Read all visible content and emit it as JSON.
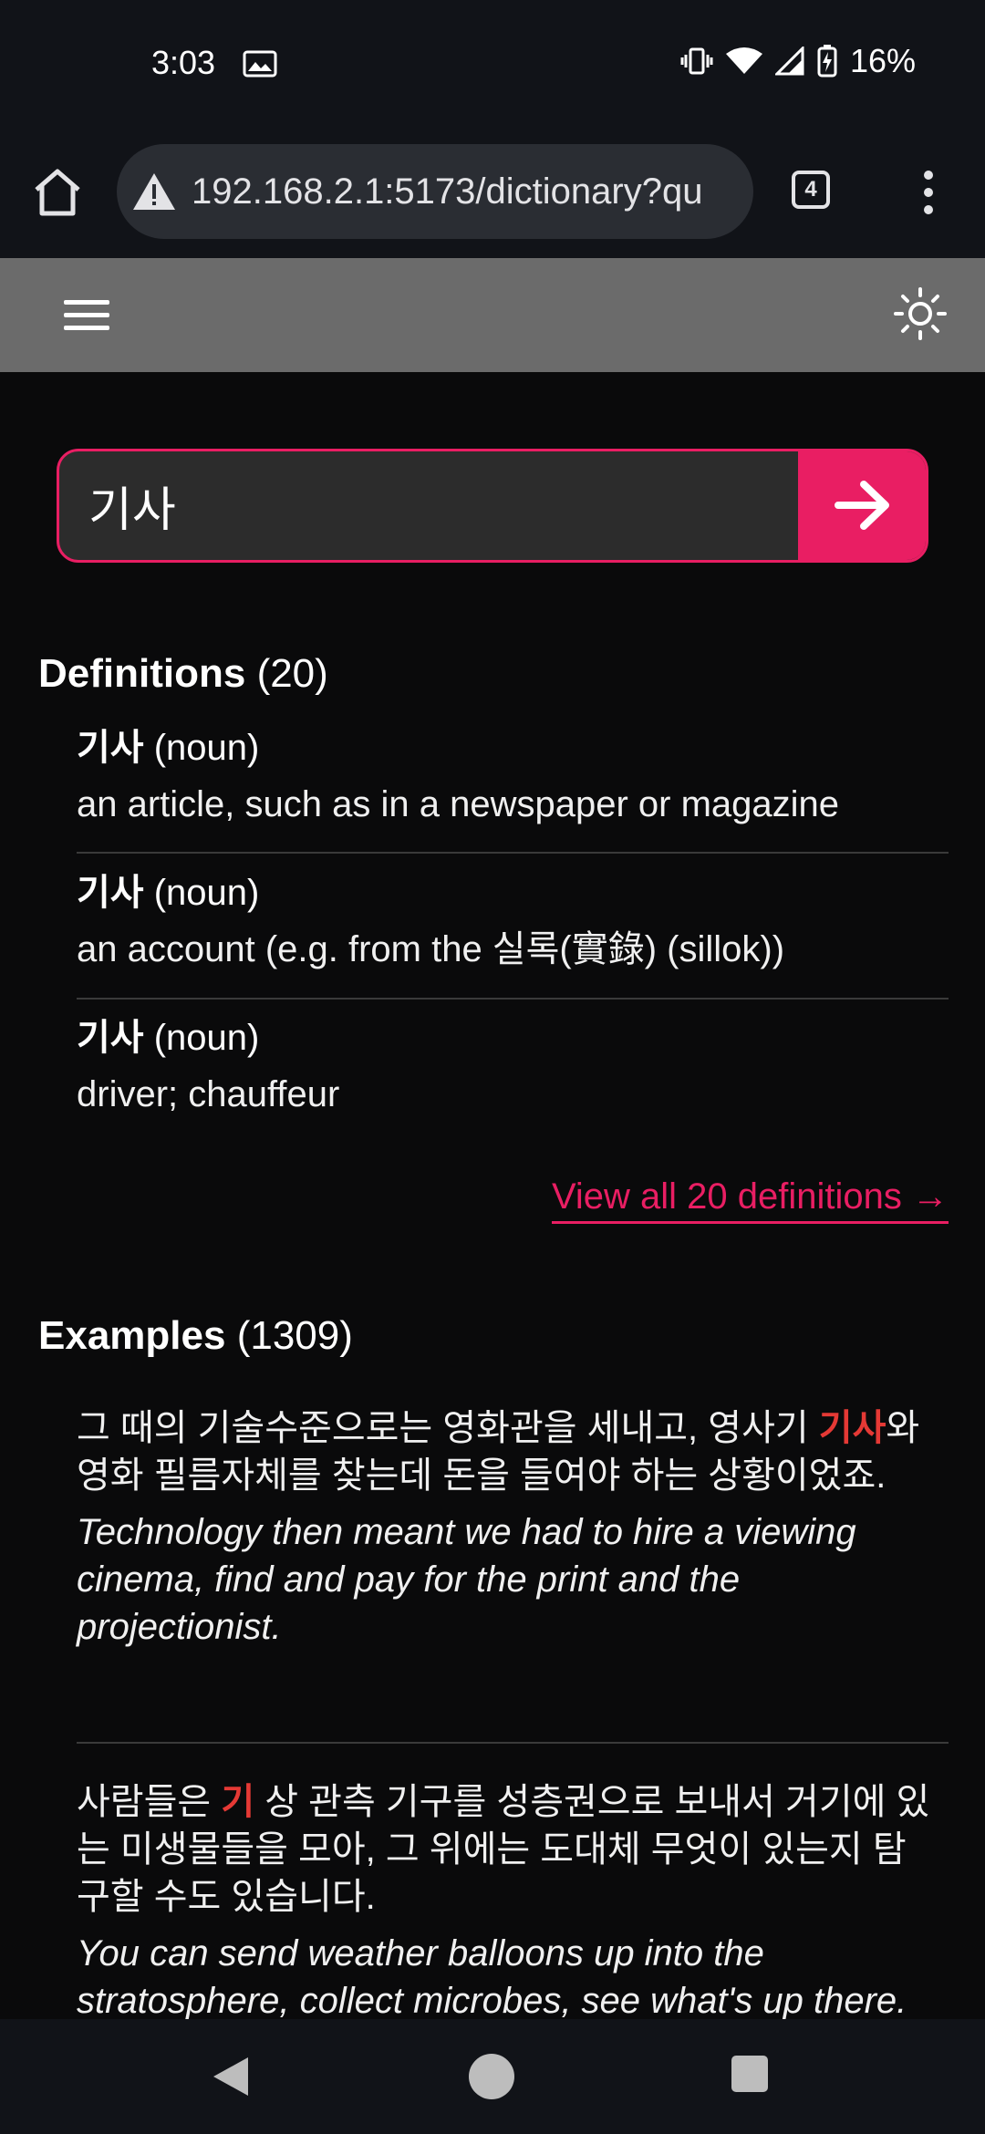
{
  "status_bar": {
    "time": "3:03",
    "battery": "16%",
    "icons": [
      "image-notification-icon",
      "vibrate-icon",
      "wifi-icon",
      "signal-icon",
      "battery-charging-icon"
    ]
  },
  "browser": {
    "url": "192.168.2.1:5173/dictionary?qu",
    "tab_count": "4"
  },
  "search": {
    "value": "기사"
  },
  "definitions": {
    "title": "Definitions",
    "count": "(20)",
    "items": [
      {
        "word": "기사",
        "pos": "(noun)",
        "meaning": "an article, such as in a newspaper or magazine"
      },
      {
        "word": "기사",
        "pos": "(noun)",
        "meaning": "an account (e.g. from the 실록(實錄) (sillok))"
      },
      {
        "word": "기사",
        "pos": "(noun)",
        "meaning": "driver; chauffeur"
      }
    ],
    "view_all": "View all 20 definitions →"
  },
  "examples": {
    "title": "Examples",
    "count": "(1309)",
    "items": [
      {
        "ko_before": "그 때의 기술수준으로는 영화관을 세내고, 영사기 ",
        "ko_highlight": "기사",
        "ko_after": "와 영화 필름자체를 찾는데 돈을 들여야 하는 상황이었죠.",
        "en": "Technology then meant we had to hire a viewing cinema, find and pay for the print and the projectionist."
      },
      {
        "ko_before": "사람들은 ",
        "ko_highlight": "기",
        "ko_after": " 상 관측 기구를 성층권으로 보내서 거기에 있는 미생물들을 모아, 그 위에는 도대체 무엇이 있는지 탐구할 수도 있습니다.",
        "en": "You can send weather balloons up into the stratosphere, collect microbes, see what's up there."
      }
    ]
  },
  "colors": {
    "accent": "#e91e63",
    "highlight": "#e53935",
    "header_bg": "#6b6b6b",
    "page_bg": "#0a0a0b"
  }
}
